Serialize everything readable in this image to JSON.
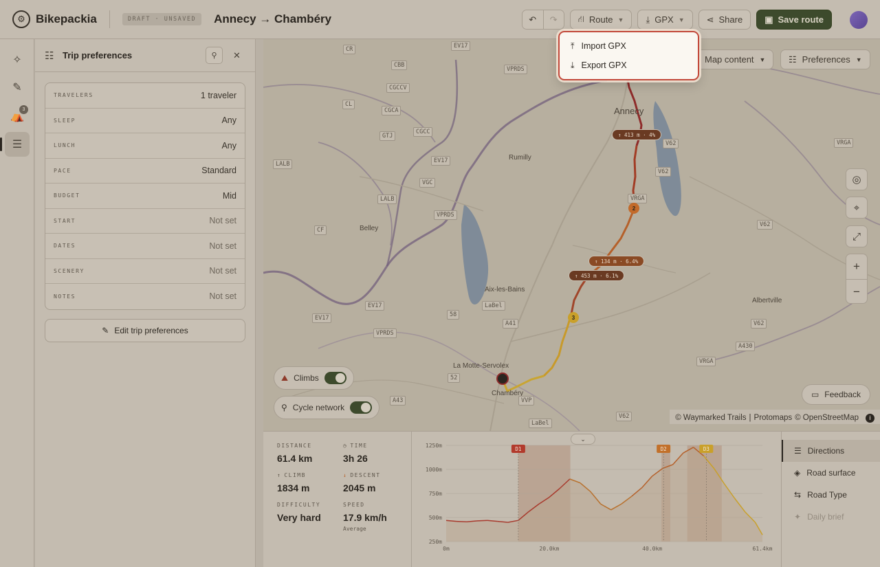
{
  "app": {
    "name": "Bikepackia",
    "status_badge": "DRAFT · UNSAVED",
    "route_title": "Annecy → Chambéry"
  },
  "toolbar": {
    "undo_icon": "undo-icon",
    "redo_icon": "redo-icon",
    "route_label": "Route",
    "gpx_label": "GPX",
    "share_label": "Share",
    "save_label": "Save route",
    "accent": "#3d4a2c"
  },
  "gpx_menu": {
    "items": [
      {
        "label": "Import GPX",
        "icon": "upload-icon"
      },
      {
        "label": "Export GPX",
        "icon": "download-icon"
      }
    ],
    "highlight_color": "#c2483a"
  },
  "rail": {
    "camp_badge": "3"
  },
  "panel": {
    "title": "Trip preferences",
    "rows": [
      {
        "key": "TRAVELERS",
        "value": "1 traveler"
      },
      {
        "key": "SLEEP",
        "value": "Any"
      },
      {
        "key": "LUNCH",
        "value": "Any"
      },
      {
        "key": "PACE",
        "value": "Standard"
      },
      {
        "key": "BUDGET",
        "value": "Mid"
      },
      {
        "key": "START",
        "value": "Not set"
      },
      {
        "key": "DATES",
        "value": "Not set"
      },
      {
        "key": "SCENERY",
        "value": "Not set"
      },
      {
        "key": "NOTES",
        "value": "Not set"
      }
    ],
    "edit_label": "Edit trip preferences"
  },
  "map": {
    "map_content_label": "Map content",
    "preferences_label": "Preferences",
    "climbs_label": "Climbs",
    "climbs_on": true,
    "cycle_network_label": "Cycle network",
    "cycle_network_on": true,
    "feedback_label": "Feedback",
    "attribution": {
      "waymarked": "© Waymarked Trails",
      "sep": "|",
      "protomaps": "Protomaps",
      "osm": "© OpenStreetMap"
    },
    "places": [
      "Annecy",
      "Rumilly",
      "Belley",
      "Aix-les-Bains",
      "La Motte-Servolex",
      "Chambéry",
      "Albertville"
    ],
    "road_shields": [
      "CR",
      "EV17",
      "VPRDS",
      "CBB",
      "CGCCV",
      "CL",
      "CGCA",
      "GTJ",
      "CGCC",
      "EV17",
      "V62",
      "VRGA",
      "LALB",
      "VGC",
      "LALB",
      "V62",
      "VRGA",
      "CF",
      "VPRDS",
      "V62",
      "EV17",
      "LaBel",
      "58",
      "EV17",
      "VPRDS",
      "A41",
      "VRGA",
      "A430",
      "V62",
      "52",
      "VVP",
      "LaBel",
      "A43",
      "V62"
    ],
    "climbs": [
      {
        "label": "↑ 413 m · 4%"
      },
      {
        "label": "↑ 134 m · 6.4%"
      },
      {
        "label": "↑ 453 m · 6.1%"
      }
    ],
    "waypoints": [
      "2",
      "3"
    ]
  },
  "stats": {
    "distance": {
      "key": "DISTANCE",
      "value": "61.4 km"
    },
    "time": {
      "key": "TIME",
      "value": "3h 26"
    },
    "climb": {
      "key": "CLIMB",
      "value": "1834 m"
    },
    "descent": {
      "key": "DESCENT",
      "value": "2045 m"
    },
    "difficulty": {
      "key": "DIFFICULTY",
      "value": "Very hard"
    },
    "speed": {
      "key": "SPEED",
      "value": "17.9 km/h",
      "sub": "Average"
    }
  },
  "chart_data": {
    "type": "area",
    "y_ticks": [
      "1250m",
      "1000m",
      "750m",
      "500m",
      "250m"
    ],
    "x_ticks": [
      "0m",
      "20.0km",
      "40.0km",
      "61.4km"
    ],
    "ylim": [
      250,
      1250
    ],
    "xlim": [
      0,
      61.4
    ],
    "day_markers": [
      {
        "label": "D1",
        "x": 14.0
      },
      {
        "label": "D2",
        "x": 42.2
      },
      {
        "label": "D3",
        "x": 50.5
      }
    ],
    "climb_bands": [
      [
        14.0,
        24.1
      ],
      [
        41.8,
        43.5
      ],
      [
        46.8,
        53.5
      ]
    ],
    "x": [
      0,
      2,
      4,
      6,
      8,
      10,
      12,
      14,
      16,
      18,
      20,
      22,
      24,
      26,
      28,
      30,
      32,
      34,
      36,
      38,
      40,
      42,
      44,
      46,
      48,
      50,
      52,
      54,
      56,
      58,
      60,
      61.4
    ],
    "elevation": [
      470,
      460,
      455,
      465,
      470,
      460,
      450,
      470,
      560,
      640,
      710,
      800,
      900,
      860,
      770,
      640,
      580,
      640,
      720,
      810,
      930,
      1010,
      1050,
      1170,
      1230,
      1140,
      1010,
      850,
      700,
      560,
      450,
      320
    ]
  },
  "tabs": [
    {
      "label": "Directions",
      "icon": "directions-icon",
      "active": true
    },
    {
      "label": "Road surface",
      "icon": "layers-icon"
    },
    {
      "label": "Road Type",
      "icon": "road-type-icon"
    },
    {
      "label": "Daily brief",
      "icon": "sparkle-icon",
      "disabled": true
    }
  ]
}
